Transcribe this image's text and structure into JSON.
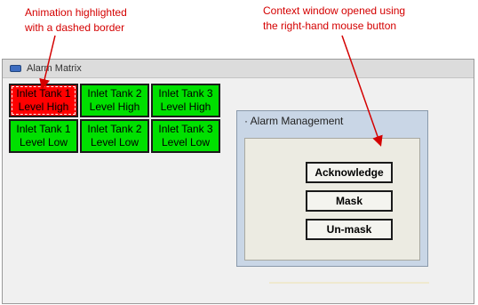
{
  "annotations": {
    "left": "Animation highlighted\nwith a dashed border",
    "right": "Context window opened using\nthe right-hand mouse button"
  },
  "colors": {
    "alarm": "#ff0000",
    "normal": "#00e000",
    "annotation": "#d40000"
  },
  "alarm_window": {
    "icon": "app-window-icon",
    "title": "Alarm Matrix",
    "tiles": [
      {
        "label": "Inlet Tank 1\nLevel High",
        "state": "alarm"
      },
      {
        "label": "Inlet Tank 2\nLevel High",
        "state": "normal"
      },
      {
        "label": "Inlet Tank 3\nLevel High",
        "state": "normal"
      },
      {
        "label": "Inlet Tank 1\nLevel Low",
        "state": "normal"
      },
      {
        "label": "Inlet Tank 2\nLevel Low",
        "state": "normal"
      },
      {
        "label": "Inlet Tank 3\nLevel Low",
        "state": "normal"
      }
    ]
  },
  "context_window": {
    "title": "· Alarm Management",
    "buttons": {
      "acknowledge": "Acknowledge",
      "mask": "Mask",
      "unmask": "Un-mask"
    }
  }
}
